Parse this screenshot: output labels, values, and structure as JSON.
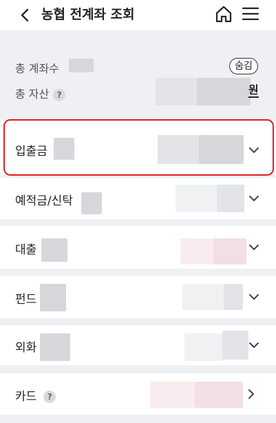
{
  "header": {
    "title": "농협 전계좌 조회",
    "back_icon": "chevron-left-icon",
    "home_icon": "home-icon",
    "menu_icon": "hamburger-menu-icon"
  },
  "summary": {
    "account_count_label": "총 계좌수",
    "total_assets_label": "총 자산",
    "help_symbol": "?",
    "hide_button_label": "숨김",
    "currency_unit": "원"
  },
  "categories": [
    {
      "label": "입출금",
      "expand_icon": "chevron-down-icon"
    },
    {
      "label": "예적금/신탁",
      "expand_icon": "chevron-down-icon"
    },
    {
      "label": "대출",
      "expand_icon": "chevron-down-icon"
    },
    {
      "label": "펀드",
      "expand_icon": "chevron-down-icon"
    },
    {
      "label": "외화",
      "expand_icon": "chevron-down-icon"
    },
    {
      "label": "카드",
      "help_symbol": "?",
      "expand_icon": "chevron-right-icon"
    }
  ],
  "colors": {
    "highlight_border": "#e02020",
    "background": "#eef0f3",
    "card": "#ffffff"
  }
}
